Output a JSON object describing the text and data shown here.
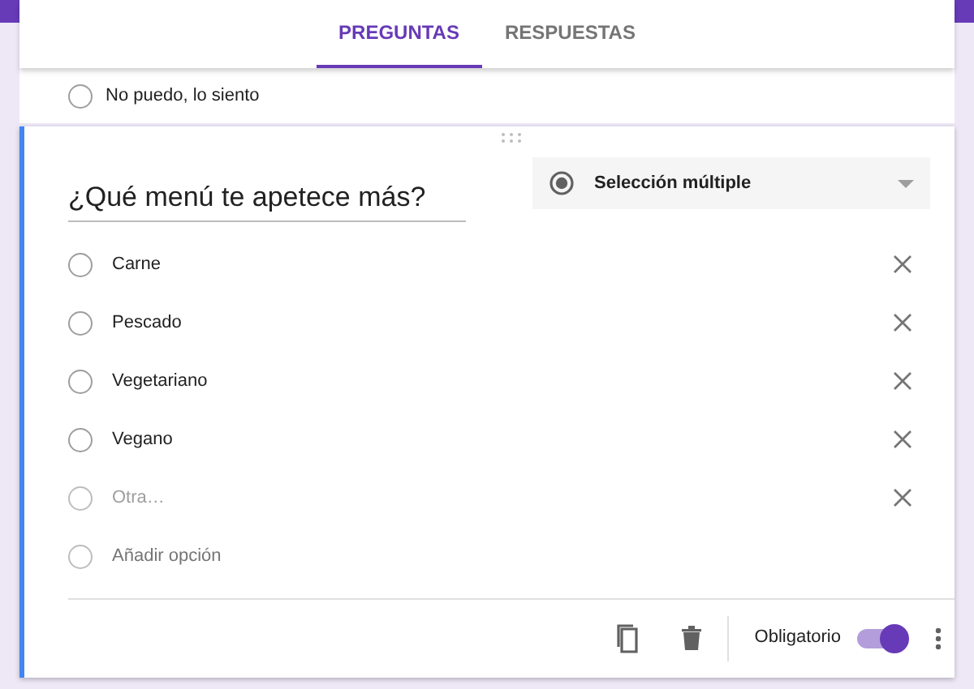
{
  "tabs": [
    {
      "label": "PREGUNTAS",
      "selected": true
    },
    {
      "label": "RESPUESTAS",
      "selected": false
    }
  ],
  "previous_question": {
    "options": [
      {
        "label": "No puedo, lo siento",
        "selected": false
      }
    ]
  },
  "question": {
    "title": "¿Qué menú te apetece más?",
    "type": {
      "label": "Selección múltiple"
    },
    "options": [
      {
        "kind": "option",
        "label": "Carne",
        "selected": false
      },
      {
        "kind": "option",
        "label": "Pescado",
        "selected": false
      },
      {
        "kind": "option",
        "label": "Vegetariano",
        "selected": false
      },
      {
        "kind": "option",
        "label": "Vegano",
        "selected": false
      },
      {
        "kind": "other",
        "label": "Otra…",
        "selected": false
      },
      {
        "kind": "add",
        "label": "Añadir opción",
        "selected": false
      }
    ],
    "required": {
      "label": "Obligatorio",
      "on": true
    }
  }
}
